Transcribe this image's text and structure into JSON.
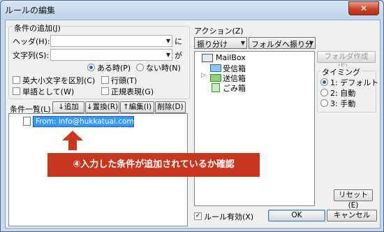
{
  "window": {
    "title": "ルールの編集",
    "close": "✕"
  },
  "conditions": {
    "group_label": "条件の追加(J)",
    "header_label": "ヘッダ(H):",
    "header_value": "",
    "header_suffix": "に",
    "string_label": "文字列(S):",
    "string_value": "",
    "string_suffix": "が",
    "radio_present": "ある時(P)",
    "radio_absent": "ない時(N)",
    "options": {
      "case_sensitive": "英大小文字を区別(C)",
      "line_start": "行頭(T)",
      "whole_word": "単語として(W)",
      "regex": "正規表現(G)"
    },
    "list_label": "条件一覧(L)",
    "buttons": {
      "add": "↓追加(A)",
      "replace": "↓置換(R)",
      "edit": "↑編集(I)",
      "delete": "削除(D)"
    },
    "items": [
      {
        "text": "From: info@hukkatuai.com",
        "selected": true
      }
    ]
  },
  "actions": {
    "label": "アクション(Z)",
    "action_select": "振り分け",
    "folder_select": "フォルダへ振り分け",
    "new_folder": "フォルダ作成(F)...",
    "tree": [
      {
        "label": "MailBox",
        "icon": "computer-icon",
        "level": 0
      },
      {
        "label": "受信箱",
        "icon": "inbox-icon",
        "level": 1
      },
      {
        "label": "送信箱",
        "icon": "outbox-icon",
        "level": 1,
        "expander": "▷"
      },
      {
        "label": "ごみ箱",
        "icon": "trash-icon",
        "level": 1
      }
    ],
    "timing_label": "タイミング",
    "timing": [
      {
        "label": "1: デフォルト",
        "checked": true
      },
      {
        "label": "2: 自動",
        "checked": false
      },
      {
        "label": "3: 手動",
        "checked": false
      }
    ],
    "reset": "リセット(E)"
  },
  "footer": {
    "rule_enabled": "ルール有効(X)",
    "rule_enabled_checked": true,
    "ok": "OK",
    "cancel": "キャンセル"
  },
  "annotation": {
    "text": "④入力した条件が追加されているか確認",
    "color": "#c8361e"
  }
}
